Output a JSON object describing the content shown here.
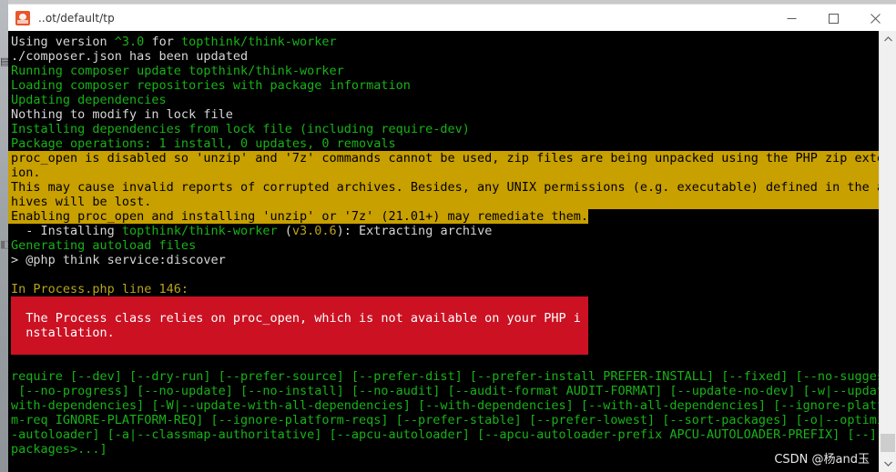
{
  "window": {
    "title": "..ot/default/tp",
    "icon": "app-icon",
    "controls": {
      "minimize": "minimize-icon",
      "maximize": "maximize-icon",
      "close": "close-icon"
    }
  },
  "terminal": {
    "lines": [
      {
        "id": "l1",
        "style": "normal",
        "segments": [
          {
            "text": "Using version ",
            "color": "white"
          },
          {
            "text": "^3.0",
            "color": "green"
          },
          {
            "text": " for ",
            "color": "white"
          },
          {
            "text": "topthink/think-worker",
            "color": "green"
          }
        ]
      },
      {
        "id": "l2",
        "style": "normal",
        "segments": [
          {
            "text": "./composer.json has been updated",
            "color": "white"
          }
        ]
      },
      {
        "id": "l3",
        "style": "normal",
        "segments": [
          {
            "text": "Running composer update topthink/think-worker",
            "color": "green"
          }
        ]
      },
      {
        "id": "l4",
        "style": "normal",
        "segments": [
          {
            "text": "Loading composer repositories with package information",
            "color": "green"
          }
        ]
      },
      {
        "id": "l5",
        "style": "normal",
        "segments": [
          {
            "text": "Updating dependencies",
            "color": "green"
          }
        ]
      },
      {
        "id": "l6",
        "style": "normal",
        "segments": [
          {
            "text": "Nothing to modify in lock file",
            "color": "white"
          }
        ]
      },
      {
        "id": "l7",
        "style": "normal",
        "segments": [
          {
            "text": "Installing dependencies from lock file (including require-dev)",
            "color": "green"
          }
        ]
      },
      {
        "id": "l8",
        "style": "normal",
        "segments": [
          {
            "text": "Package operations: 1 install, 0 updates, 0 removals",
            "color": "green"
          }
        ]
      },
      {
        "id": "l9",
        "style": "warn-full",
        "segments": [
          {
            "text": "proc_open is disabled so 'unzip' and '7z' commands cannot be used, zip files are being unpacked using the PHP zip extens",
            "color": "black"
          }
        ]
      },
      {
        "id": "l10",
        "style": "warn-full",
        "segments": [
          {
            "text": "ion.",
            "color": "black"
          }
        ]
      },
      {
        "id": "l11",
        "style": "warn-full",
        "segments": [
          {
            "text": "This may cause invalid reports of corrupted archives. Besides, any UNIX permissions (e.g. executable) defined in the arc",
            "color": "black"
          }
        ]
      },
      {
        "id": "l12",
        "style": "warn-full",
        "segments": [
          {
            "text": "hives will be lost.",
            "color": "black"
          }
        ]
      },
      {
        "id": "l13",
        "style": "warn-partial",
        "segments": [
          {
            "text": "Enabling proc_open and installing 'unzip' or '7z' (21.01+) may remediate them.",
            "color": "black"
          }
        ]
      },
      {
        "id": "l14",
        "style": "normal",
        "segments": [
          {
            "text": "  - Installing ",
            "color": "white"
          },
          {
            "text": "topthink/think-worker",
            "color": "green"
          },
          {
            "text": " (",
            "color": "white"
          },
          {
            "text": "v3.0.6",
            "color": "yellow"
          },
          {
            "text": "): Extracting archive",
            "color": "white"
          }
        ]
      },
      {
        "id": "l15",
        "style": "normal",
        "segments": [
          {
            "text": "Generating autoload files",
            "color": "green"
          }
        ]
      },
      {
        "id": "l16",
        "style": "normal",
        "segments": [
          {
            "text": "> @php think service:discover",
            "color": "white"
          }
        ]
      },
      {
        "id": "l17",
        "style": "normal",
        "segments": [
          {
            "text": "",
            "color": "white"
          }
        ]
      },
      {
        "id": "l18",
        "style": "normal",
        "segments": [
          {
            "text": "In Process.php line 146:",
            "color": "yellow"
          }
        ]
      }
    ],
    "error_box": {
      "color": "#cc1122",
      "lines": [
        "",
        "  The Process class relies on proc_open, which is not available on your PHP i",
        "  nstallation.",
        ""
      ]
    },
    "usage_lines": [
      "require [--dev] [--dry-run] [--prefer-source] [--prefer-dist] [--prefer-install PREFER-INSTALL] [--fixed] [--no-suggest]",
      " [--no-progress] [--no-update] [--no-install] [--no-audit] [--audit-format AUDIT-FORMAT] [--update-no-dev] [-w|--update-",
      "with-dependencies] [-W|--update-with-all-dependencies] [--with-dependencies] [--with-all-dependencies] [--ignore-platfor",
      "m-req IGNORE-PLATFORM-REQ] [--ignore-platform-reqs] [--prefer-stable] [--prefer-lowest] [--sort-packages] [-o|--optimize",
      "-autoloader] [-a|--classmap-authoritative] [--apcu-autoloader] [--apcu-autoloader-prefix APCU-AUTOLOADER-PREFIX] [--] [<",
      "packages>...]"
    ],
    "watermark": "CSDN @杨and玉"
  },
  "scrollbar": {
    "up_arrow": "chevron-up-icon",
    "down_arrow": "chevron-down-icon"
  },
  "colors": {
    "green": "#18b218",
    "white": "#d6d6d6",
    "yellow": "#b9a31b",
    "warn_bg": "#c8a000",
    "error_bg": "#cc1122",
    "terminal_bg": "#000000"
  }
}
